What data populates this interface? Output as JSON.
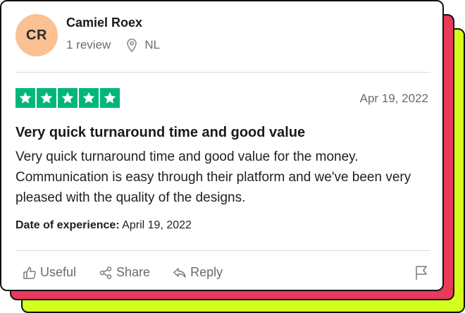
{
  "reviewer": {
    "initials": "CR",
    "name": "Camiel Roex",
    "review_count": "1 review",
    "country": "NL"
  },
  "review": {
    "rating": 5,
    "date": "Apr 19, 2022",
    "title": "Very quick turnaround time and good value",
    "body": "Very quick turnaround time and good value for the money. Communication is easy through their platform and we've been very pleased with the quality of the designs.",
    "experience_label": "Date of experience:",
    "experience_date": "April 19, 2022"
  },
  "actions": {
    "useful": "Useful",
    "share": "Share",
    "reply": "Reply"
  },
  "icons": {
    "location": "location-pin-icon",
    "star": "star-icon",
    "useful": "thumbs-up-icon",
    "share": "share-icon",
    "reply": "reply-icon",
    "flag": "flag-icon"
  },
  "colors": {
    "star_green": "#00b67a",
    "avatar_bg": "#fbc193",
    "back_card_red": "#e83a5b",
    "back_card_lime": "#d3ff1c"
  }
}
